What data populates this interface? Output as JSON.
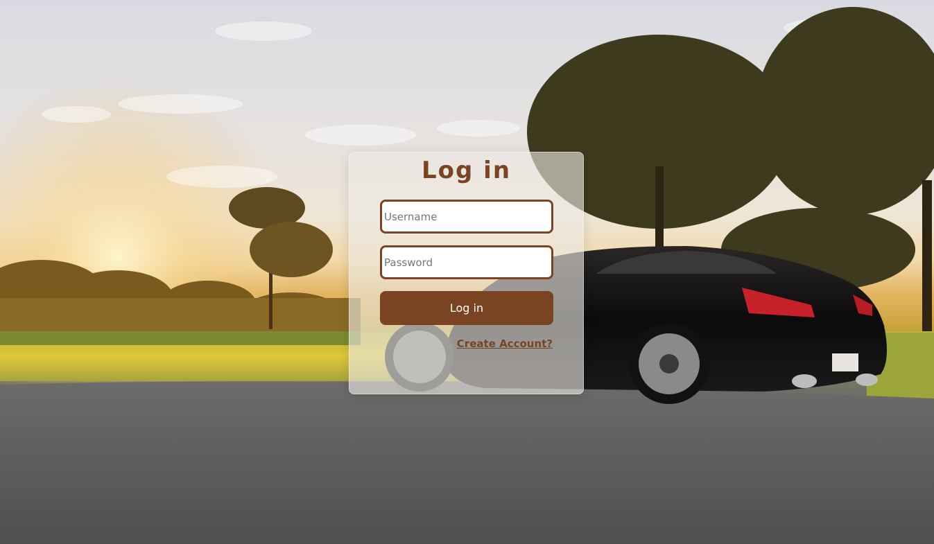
{
  "login": {
    "title": "Log in",
    "username_placeholder": "Username",
    "password_placeholder": "Password",
    "button_label": "Log in",
    "create_account_label": "Create Account?"
  },
  "theme": {
    "accent": "#7a4423",
    "card_bg": "rgba(235,232,228,0.62)"
  },
  "background": {
    "description_icon": "sunset-car-photo"
  }
}
